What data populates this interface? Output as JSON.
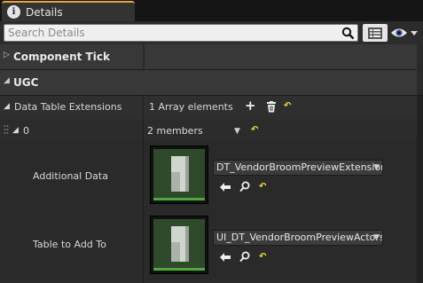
{
  "tab": {
    "icon": "info-icon",
    "icon_glyph": "i",
    "label": "Details"
  },
  "search": {
    "placeholder": "Search Details",
    "value": ""
  },
  "categories": {
    "component_tick": {
      "label": "Component Tick",
      "expanded": false
    },
    "ugc": {
      "label": "UGC",
      "expanded": true
    }
  },
  "property": {
    "name": "Data Table Extensions",
    "count_text": "1 Array elements",
    "element": {
      "index": "0",
      "members_text": "2 members",
      "fields": [
        {
          "label": "Additional Data",
          "asset": "DT_VendorBroomPreviewExtension"
        },
        {
          "label": "Table to Add To",
          "asset": "UI_DT_VendorBroomPreviewActors"
        }
      ]
    }
  },
  "icons": {
    "reset": "↶",
    "expand_open": "◢",
    "expand_closed": "▷",
    "dropdown": "▼",
    "plus": "+"
  },
  "colors": {
    "tab_accent": "#e8a33a",
    "thumb_bar": "#4da93a",
    "reset_yellow": "#f0e040"
  }
}
